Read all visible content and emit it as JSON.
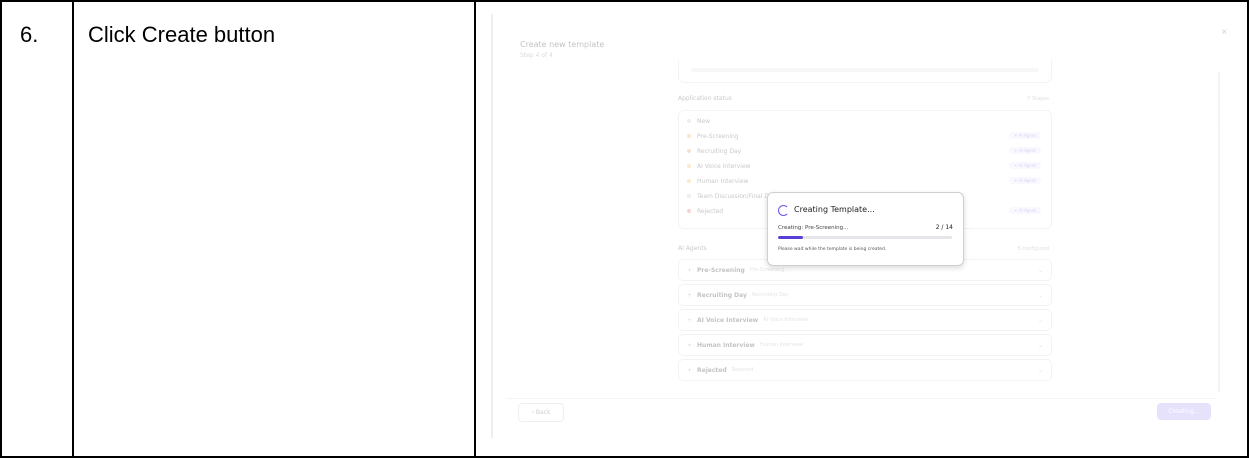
{
  "doc": {
    "step_number": "6.",
    "instruction": "Click Create button"
  },
  "modal": {
    "title": "Create new template",
    "step": "Step 4 of 4",
    "close_label": "×",
    "application_status": {
      "heading": "Application status",
      "meta": "7 Stages",
      "stages": [
        {
          "label": "New",
          "color": "#c9c9c9",
          "tag": ""
        },
        {
          "label": "Pre-Screening",
          "color": "#e8b070",
          "tag": "✦ AI Agent"
        },
        {
          "label": "Recruiting Day",
          "color": "#e8a070",
          "tag": "✦ AI Agent"
        },
        {
          "label": "AI Voice Interview",
          "color": "#f0c070",
          "tag": "✦ AI Agent"
        },
        {
          "label": "Human Interview",
          "color": "#f0c070",
          "tag": "✦ AI Agent"
        },
        {
          "label": "Team Discussion/Final De",
          "color": "#c9c9c9",
          "tag": ""
        },
        {
          "label": "Rejected",
          "color": "#f07070",
          "tag": "✦ AI Agent"
        }
      ]
    },
    "ai_agents": {
      "heading": "AI Agents",
      "meta": "5 configured",
      "items": [
        {
          "name": "Pre-Screening",
          "sub": "Pre-Screening"
        },
        {
          "name": "Recruiting Day",
          "sub": "Recruiting Day"
        },
        {
          "name": "AI Voice Interview",
          "sub": "AI Voice Interview"
        },
        {
          "name": "Human Interview",
          "sub": "Human Interview"
        },
        {
          "name": "Rejected",
          "sub": "Rejected"
        }
      ]
    },
    "back_label": "‹  Back",
    "create_label": "Creating..."
  },
  "progress_popup": {
    "title": "Creating Template...",
    "current": "Creating: Pre-Screening...",
    "count": "2 / 14",
    "progress": 0.143,
    "note": "Please wait while the template is being created.",
    "accent": "#5a3fd6"
  }
}
